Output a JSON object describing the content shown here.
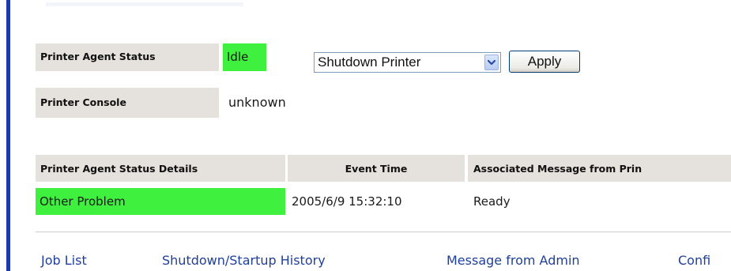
{
  "status": {
    "agent_status_label": "Printer Agent Status",
    "agent_status_value": "Idle",
    "console_label": "Printer Console",
    "console_value": "unknown"
  },
  "action": {
    "selected_option": "Shutdown Printer",
    "apply_label": "Apply"
  },
  "details": {
    "headers": [
      "Printer Agent Status Details",
      "Event Time",
      "Associated Message from Prin"
    ],
    "row": [
      "Other Problem",
      "2005/6/9 15:32:10",
      "Ready"
    ]
  },
  "nav": {
    "items": [
      "Job List",
      "Shutdown/Startup History",
      "Message from Admin",
      "Confi"
    ]
  },
  "colors": {
    "status_green": "#3ff03f",
    "label_bg": "#e5e2dd",
    "link": "#1f3f9a",
    "left_bar": "#1e3aa8"
  },
  "icons": {
    "select_arrow": "chevron-down-icon"
  }
}
